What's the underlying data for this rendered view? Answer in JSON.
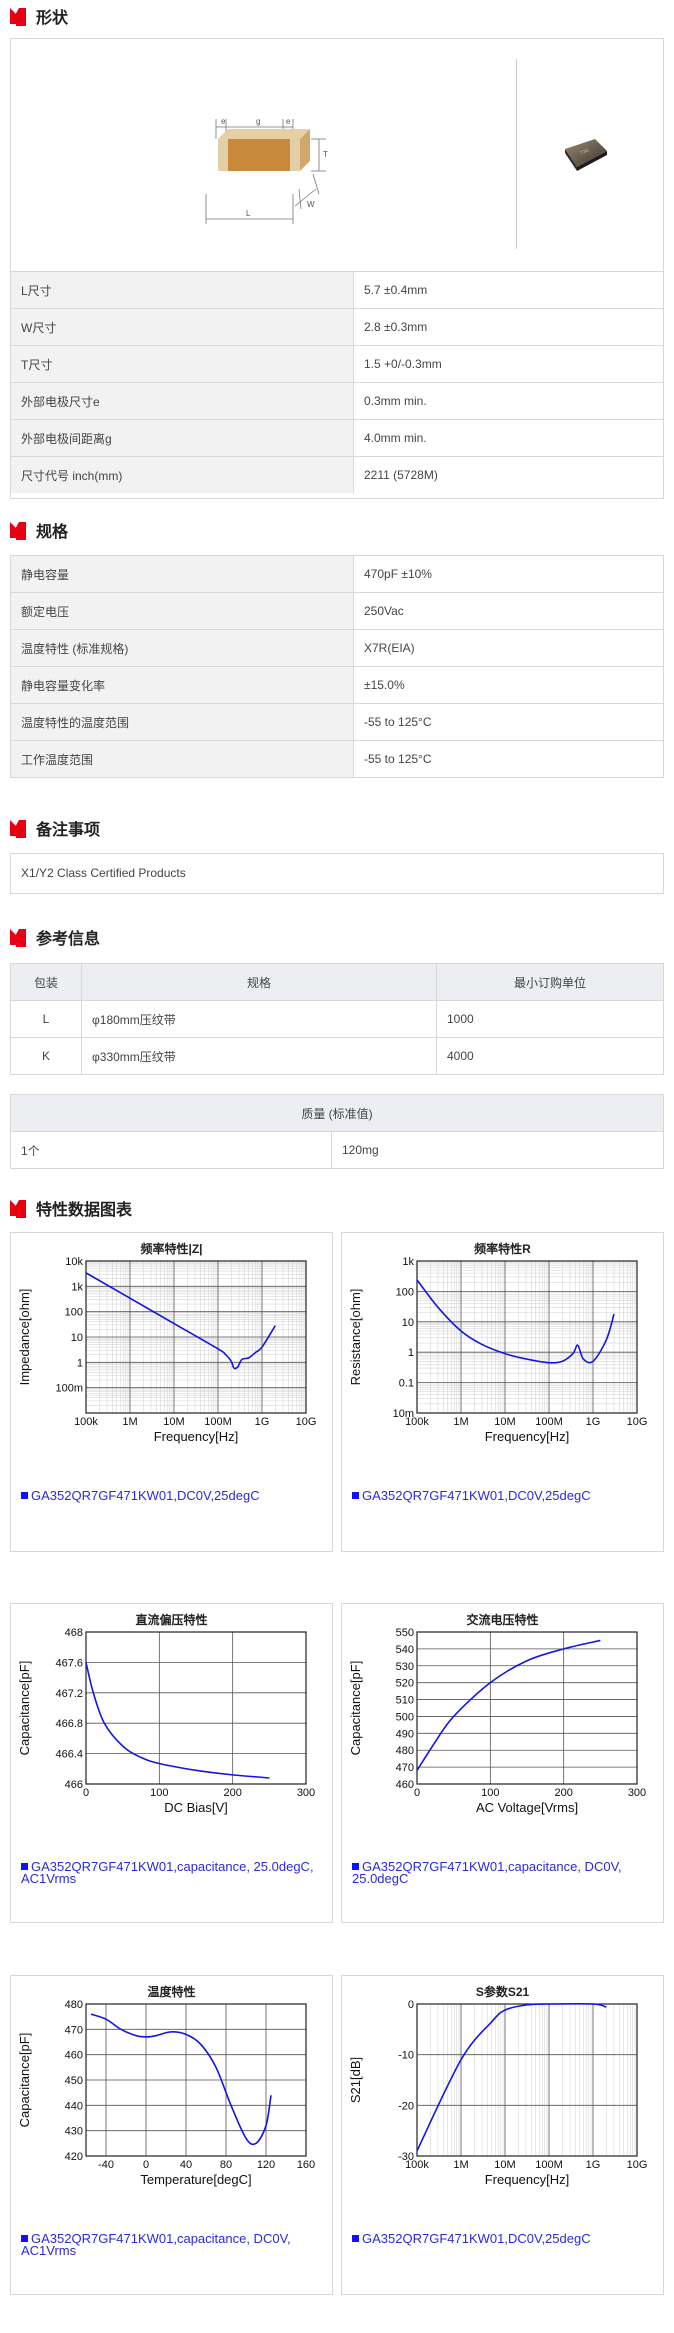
{
  "sections": {
    "shape": "形状",
    "spec": "规格",
    "notes": "备注事项",
    "reference": "参考信息",
    "charts": "特性数据图表"
  },
  "shape_diagram": {
    "e": "e",
    "g": "g",
    "t": "T",
    "w": "W",
    "l": "L"
  },
  "dimensions": [
    {
      "label": "L尺寸",
      "value": "5.7 ±0.4mm"
    },
    {
      "label": "W尺寸",
      "value": "2.8 ±0.3mm"
    },
    {
      "label": "T尺寸",
      "value": "1.5 +0/-0.3mm"
    },
    {
      "label": "外部电极尺寸e",
      "value": "0.3mm min."
    },
    {
      "label": "外部电极间距离g",
      "value": "4.0mm min."
    },
    {
      "label": "尺寸代号 inch(mm)",
      "value": "2211 (5728M)"
    }
  ],
  "specs": [
    {
      "label": "静电容量",
      "value": "470pF ±10%"
    },
    {
      "label": "额定电压",
      "value": "250Vac"
    },
    {
      "label": "温度特性 (标准规格)",
      "value": "X7R(EIA)"
    },
    {
      "label": "静电容量变化率",
      "value": "±15.0%"
    },
    {
      "label": "温度特性的温度范围",
      "value": "-55 to 125°C"
    },
    {
      "label": "工作温度范围",
      "value": "-55 to 125°C"
    }
  ],
  "notes_text": "X1/Y2 Class Certified Products",
  "packaging": {
    "headers": [
      "包装",
      "规格",
      "最小订购单位"
    ],
    "rows": [
      [
        "L",
        "φ180mm压纹带",
        "1000"
      ],
      [
        "K",
        "φ330mm压纹带",
        "4000"
      ]
    ]
  },
  "mass": {
    "header": "质量 (标准值)",
    "unit": "1个",
    "value": "120mg"
  },
  "chart_data": [
    {
      "type": "line",
      "title": "频率特性|Z|",
      "xlabel": "Frequency[Hz]",
      "ylabel": "Impedance[ohm]",
      "xscale": "log",
      "yscale": "log",
      "xlim": [
        100000,
        10000000000
      ],
      "ylim": [
        0.01,
        10000
      ],
      "xticks": [
        "100k",
        "1M",
        "10M",
        "100M",
        "1G",
        "10G"
      ],
      "yticks": [
        "10k",
        "1k",
        "100",
        "10",
        "1",
        "100m"
      ],
      "legend": "GA352QR7GF471KW01,DC0V,25degC",
      "x": [
        100000,
        1000000,
        10000000,
        100000000,
        150000000,
        200000000,
        230000000,
        280000000,
        350000000,
        500000000,
        700000000,
        1000000000,
        2000000000
      ],
      "y": [
        3400,
        340,
        34,
        3.4,
        2.0,
        1.1,
        0.6,
        0.65,
        1.3,
        1.5,
        2.4,
        4.0,
        28
      ]
    },
    {
      "type": "line",
      "title": "频率特性R",
      "xlabel": "Frequency[Hz]",
      "ylabel": "Resistance[ohm]",
      "xscale": "log",
      "yscale": "log",
      "xlim": [
        100000,
        10000000000
      ],
      "ylim": [
        0.01,
        1000
      ],
      "xticks": [
        "100k",
        "1M",
        "10M",
        "100M",
        "1G",
        "10G"
      ],
      "yticks": [
        "1k",
        "100",
        "10",
        "1",
        "0.1",
        "10m"
      ],
      "legend": "GA352QR7GF471KW01,DC0V,25degC",
      "x": [
        100000,
        300000,
        1000000,
        3000000,
        10000000,
        30000000,
        100000000,
        200000000,
        350000000,
        450000000,
        600000000,
        1000000000,
        2000000000,
        3000000000
      ],
      "y": [
        240,
        30,
        5,
        1.8,
        0.9,
        0.6,
        0.45,
        0.5,
        0.9,
        1.7,
        0.6,
        0.5,
        2.5,
        18
      ]
    },
    {
      "type": "line",
      "title": "直流偏压特性",
      "xlabel": "DC Bias[V]",
      "ylabel": "Capacitance[pF]",
      "xlim": [
        0,
        300
      ],
      "ylim": [
        466,
        468
      ],
      "xticks": [
        "0",
        "100",
        "200",
        "300"
      ],
      "yticks": [
        "468",
        "467.6",
        "467.2",
        "466.8",
        "466.4",
        "466"
      ],
      "legend": "GA352QR7GF471KW01,capacitance, 25.0degC, AC1Vrms",
      "x": [
        0,
        10,
        25,
        50,
        75,
        100,
        150,
        200,
        250
      ],
      "y": [
        467.6,
        467.2,
        466.8,
        466.5,
        466.35,
        466.27,
        466.18,
        466.12,
        466.08
      ]
    },
    {
      "type": "line",
      "title": "交流电压特性",
      "xlabel": "AC Voltage[Vrms]",
      "ylabel": "Capacitance[pF]",
      "xlim": [
        0,
        300
      ],
      "ylim": [
        460,
        550
      ],
      "xticks": [
        "0",
        "100",
        "200",
        "300"
      ],
      "yticks": [
        "550",
        "540",
        "530",
        "520",
        "510",
        "500",
        "490",
        "480",
        "470",
        "460"
      ],
      "legend": "GA352QR7GF471KW01,capacitance, DC0V, 25.0degC",
      "x": [
        0,
        25,
        50,
        100,
        150,
        200,
        250
      ],
      "y": [
        468,
        485,
        500,
        520,
        533,
        540,
        545
      ]
    },
    {
      "type": "line",
      "title": "温度特性",
      "xlabel": "Temperature[degC]",
      "ylabel": "Capacitance[pF]",
      "xlim": [
        -60,
        160
      ],
      "ylim": [
        420,
        480
      ],
      "xticks": [
        "-40",
        "0",
        "40",
        "80",
        "120",
        "160"
      ],
      "yticks": [
        "480",
        "470",
        "460",
        "450",
        "440",
        "430",
        "420"
      ],
      "legend": "GA352QR7GF471KW01,capacitance, DC0V, AC1Vrms",
      "x": [
        -55,
        -40,
        -25,
        -10,
        0,
        10,
        25,
        40,
        55,
        70,
        85,
        100,
        110,
        120,
        125
      ],
      "y": [
        476,
        474,
        470,
        467.5,
        467,
        467.5,
        469,
        468,
        464,
        455,
        440,
        427,
        425,
        432,
        444
      ]
    },
    {
      "type": "line",
      "title": "S参数S21",
      "xlabel": "Frequency[Hz]",
      "ylabel": "S21[dB]",
      "xscale": "log",
      "xlim": [
        100000,
        10000000000
      ],
      "ylim": [
        -30,
        0
      ],
      "xticks": [
        "100k",
        "1M",
        "10M",
        "100M",
        "1G",
        "10G"
      ],
      "yticks": [
        "0",
        "-10",
        "-20",
        "-30"
      ],
      "legend": "GA352QR7GF471KW01,DC0V,25degC",
      "x": [
        100000,
        1000000,
        5000000,
        10000000,
        30000000,
        100000000,
        1000000000,
        2000000000
      ],
      "y": [
        -29,
        -11,
        -3.5,
        -1.2,
        -0.2,
        0,
        0,
        -0.6
      ]
    }
  ]
}
